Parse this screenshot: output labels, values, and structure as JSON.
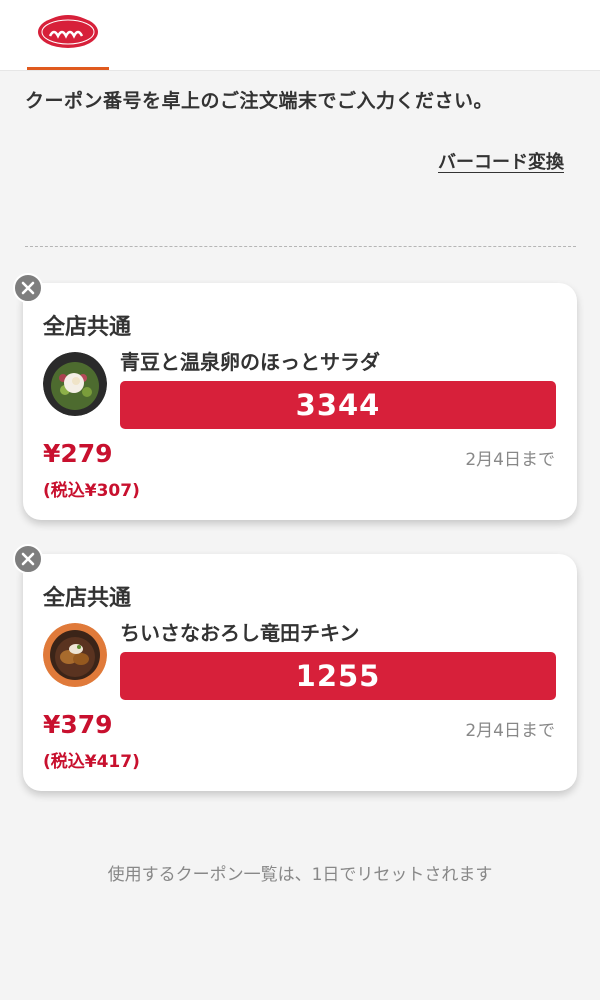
{
  "header": {
    "logo_alt": "COFFEE & RESTAURANT ジョナサン",
    "brand_color": "#d7203a",
    "accent_color": "#e05a1e"
  },
  "instruction": "クーポン番号を卓上のご注文端末でご入力ください。",
  "barcode_link": "バーコード変換",
  "coupons": [
    {
      "scope": "全店共通",
      "name": "青豆と温泉卵のほっとサラダ",
      "code": "3344",
      "price": "¥279",
      "tax_price": "(税込¥307)",
      "expiry": "2月4日まで",
      "image_icon": "salad-photo"
    },
    {
      "scope": "全店共通",
      "name": "ちいさなおろし竜田チキン",
      "code": "1255",
      "price": "¥379",
      "tax_price": "(税込¥417)",
      "expiry": "2月4日まで",
      "image_icon": "chicken-photo"
    }
  ],
  "footer_note": "使用するクーポン一覧は、1日でリセットされます"
}
